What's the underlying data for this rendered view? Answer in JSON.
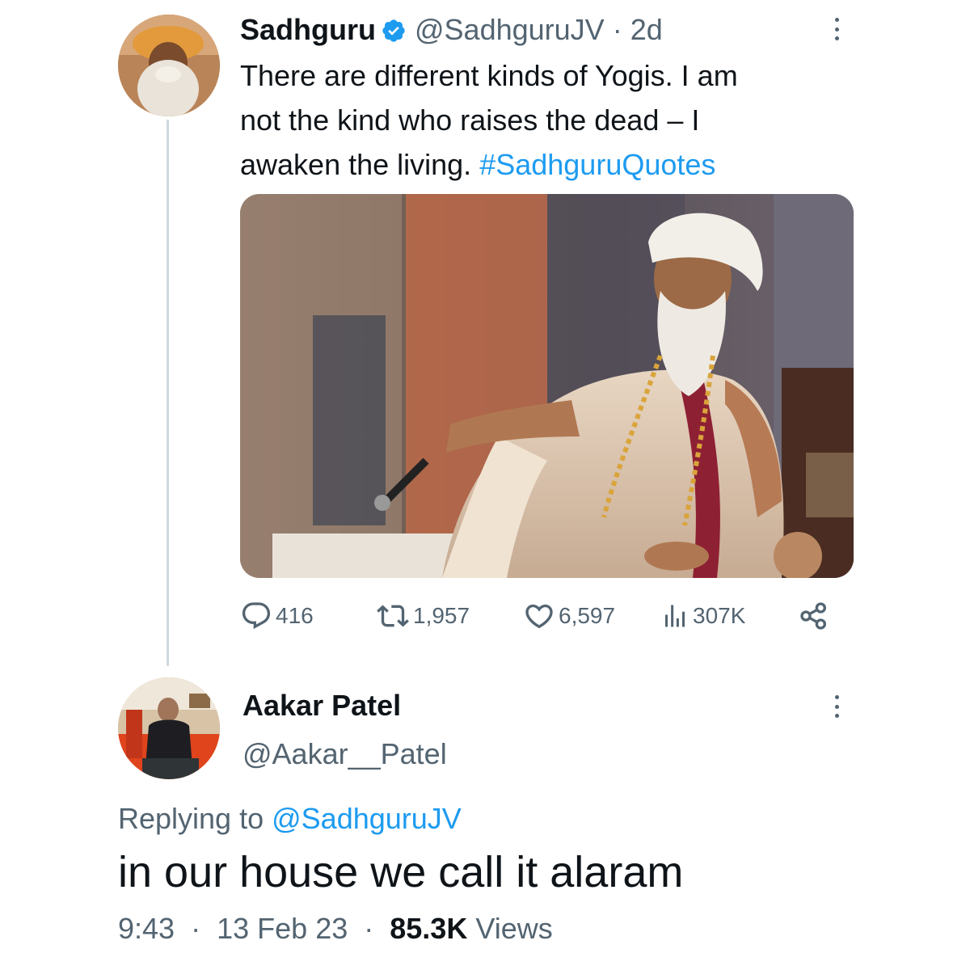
{
  "tweet": {
    "author": {
      "display_name": "Sadhguru",
      "handle": "@SadhguruJV",
      "time_ago": "2d",
      "separator": "·",
      "verified": true,
      "avatar_icon": "avatar-sadhguru"
    },
    "text_lines": [
      "There are different kinds of Yogis. I am",
      "not the kind who raises the dead – I",
      "awaken the living. "
    ],
    "hashtag": "#SadhguruQuotes",
    "media_description_icon": "photo",
    "stats": {
      "replies": "416",
      "retweets": "1,957",
      "likes": "6,597",
      "views": "307K"
    }
  },
  "reply": {
    "author": {
      "display_name": "Aakar Patel",
      "handle": "@Aakar__Patel",
      "avatar_icon": "avatar-aakar-patel"
    },
    "replying_to_prefix": "Replying to ",
    "replying_to_handle": "@SadhguruJV",
    "text": "in our house we call it alaram",
    "time": "9:43",
    "date": "13 Feb 23",
    "views_count": "85.3K",
    "views_label": " Views",
    "separator": "·"
  },
  "colors": {
    "text": "#0f1419",
    "secondary": "#536471",
    "accent": "#1d9bf0",
    "thread_line": "#cfd9de"
  }
}
